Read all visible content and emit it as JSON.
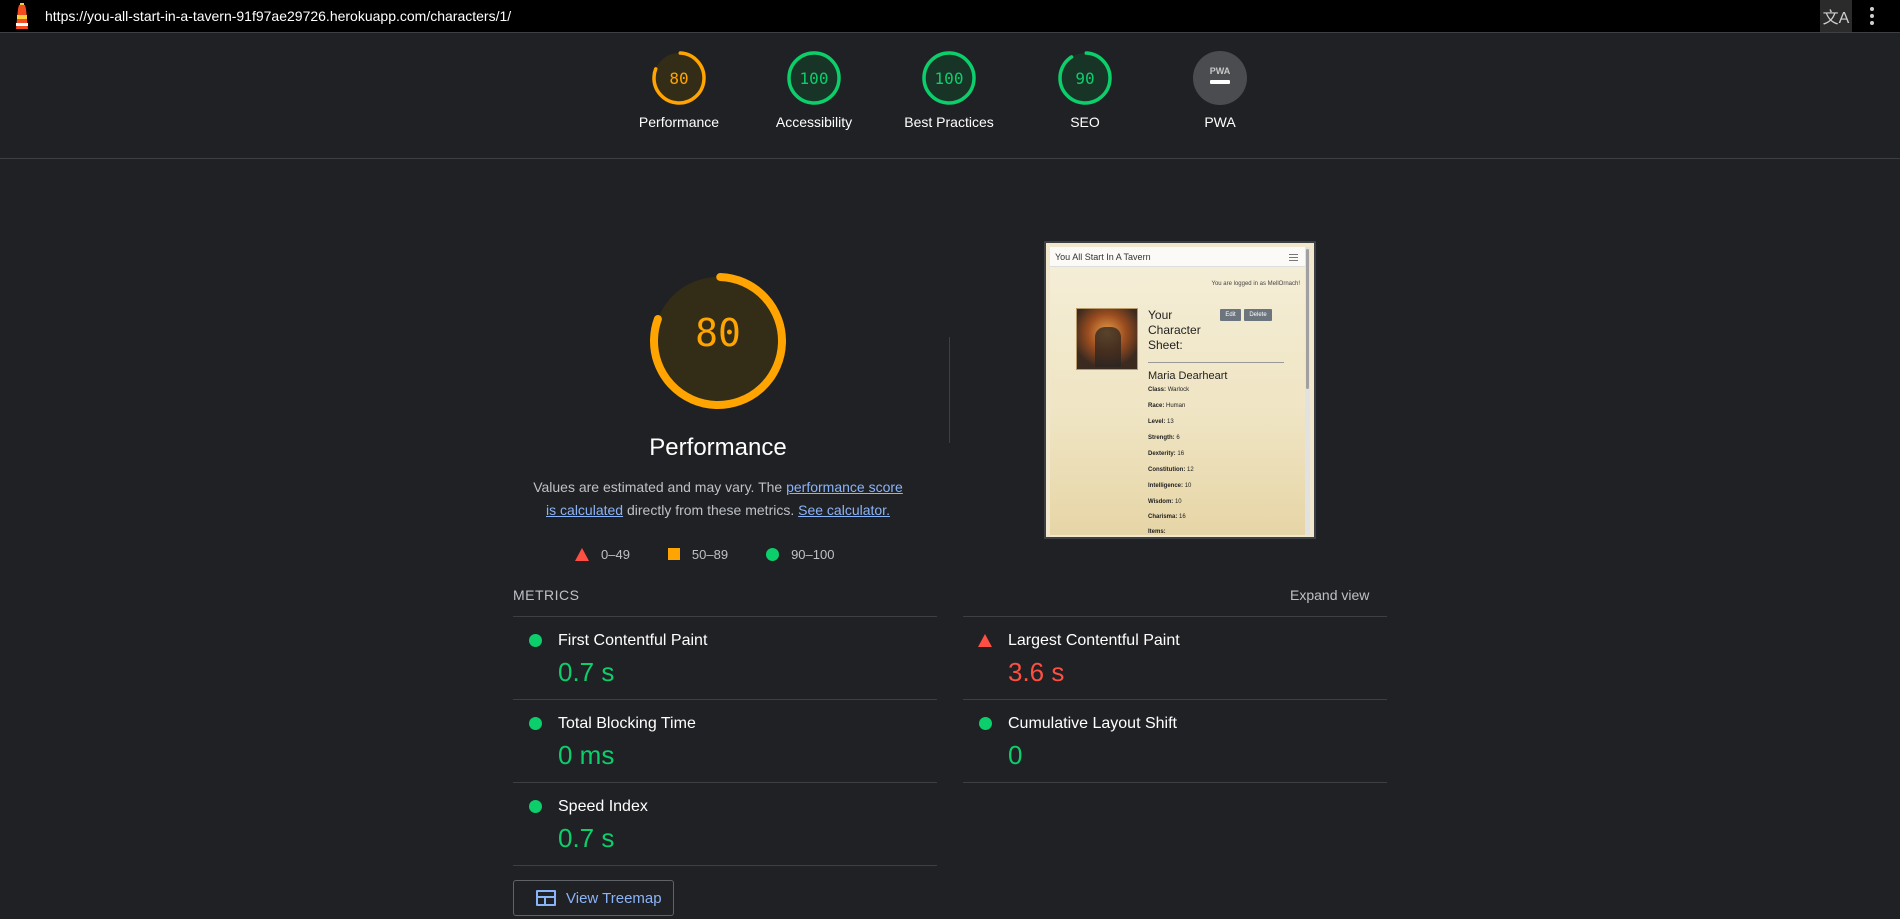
{
  "browser": {
    "url": "https://you-all-start-in-a-tavern-91f97ae29726.herokuapp.com/characters/1/"
  },
  "colors": {
    "pass": "#0cce6b",
    "average": "#ffa400",
    "fail": "#ff4e42",
    "na": "#5f6368",
    "link": "#8ab4f8"
  },
  "scores": [
    {
      "label": "Performance",
      "value": "80",
      "score": 80,
      "status": "average"
    },
    {
      "label": "Accessibility",
      "value": "100",
      "score": 100,
      "status": "pass"
    },
    {
      "label": "Best Practices",
      "value": "100",
      "score": 100,
      "status": "pass"
    },
    {
      "label": "SEO",
      "value": "90",
      "score": 90,
      "status": "pass"
    },
    {
      "label": "PWA",
      "value": "",
      "score": 0,
      "status": "na",
      "icon": "PWA"
    }
  ],
  "performance": {
    "score": "80",
    "score_fraction": 0.8,
    "title": "Performance",
    "desc_prefix": "Values are estimated and may vary. The ",
    "desc_link": "performance score is calculated",
    "desc_middle": " directly from these metrics. ",
    "desc_calc_link": "See calculator.",
    "legend": [
      {
        "range": "0–49",
        "shape": "triangle"
      },
      {
        "range": "50–89",
        "shape": "square"
      },
      {
        "range": "90–100",
        "shape": "circle"
      }
    ]
  },
  "thumbnail": {
    "site_title": "You All Start In A Tavern",
    "logged_in": "You are logged in as MellOrnach!",
    "heading": "Your Character Sheet:",
    "edit": "Edit",
    "delete": "Delete",
    "name": "Maria Dearheart",
    "stats": [
      {
        "label": "Class:",
        "value": "Warlock"
      },
      {
        "label": "Race:",
        "value": "Human"
      },
      {
        "label": "Level:",
        "value": "13"
      },
      {
        "label": "Strength:",
        "value": "6"
      },
      {
        "label": "Dexterity:",
        "value": "16"
      },
      {
        "label": "Constitution:",
        "value": "12"
      },
      {
        "label": "Intelligence:",
        "value": "10"
      },
      {
        "label": "Wisdom:",
        "value": "10"
      },
      {
        "label": "Charisma:",
        "value": "16"
      },
      {
        "label": "Items:",
        "value": ""
      }
    ]
  },
  "metrics": {
    "title": "METRICS",
    "expand": "Expand view",
    "items": [
      {
        "name": "First Contentful Paint",
        "value": "0.7 s",
        "status": "pass"
      },
      {
        "name": "Largest Contentful Paint",
        "value": "3.6 s",
        "status": "fail"
      },
      {
        "name": "Total Blocking Time",
        "value": "0 ms",
        "status": "pass"
      },
      {
        "name": "Cumulative Layout Shift",
        "value": "0",
        "status": "pass"
      },
      {
        "name": "Speed Index",
        "value": "0.7 s",
        "status": "pass"
      }
    ],
    "treemap_button": "View Treemap"
  }
}
